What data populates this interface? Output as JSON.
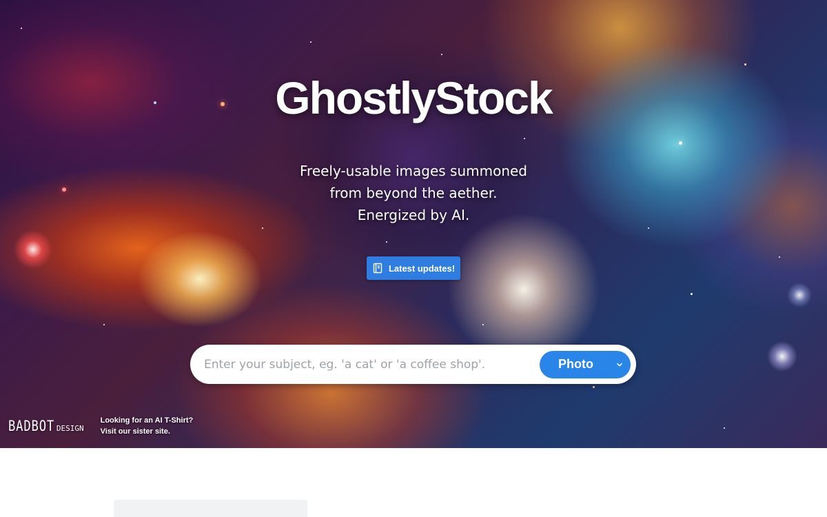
{
  "brand": {
    "title": "GhostlyStock"
  },
  "hero": {
    "tagline_lines": [
      "Freely-usable images summoned",
      "from beyond the aether.",
      "Energized by AI."
    ],
    "updates_button_label": "Latest updates!",
    "updates_icon": "book-icon"
  },
  "search": {
    "placeholder": "Enter your subject, eg. 'a cat' or 'a coffee shop'.",
    "value": "",
    "type_selected": "Photo",
    "type_icon": "chevron-down-icon"
  },
  "sister_site": {
    "logo_text": "BADBOT",
    "logo_subtext": "DESIGN",
    "line1": "Looking for an AI T-Shirt?",
    "line2": "Visit our sister site."
  },
  "colors": {
    "accent": "#2a85e8",
    "button_blue": "#2f7de1",
    "placeholder_gray": "#f1f2f3"
  }
}
